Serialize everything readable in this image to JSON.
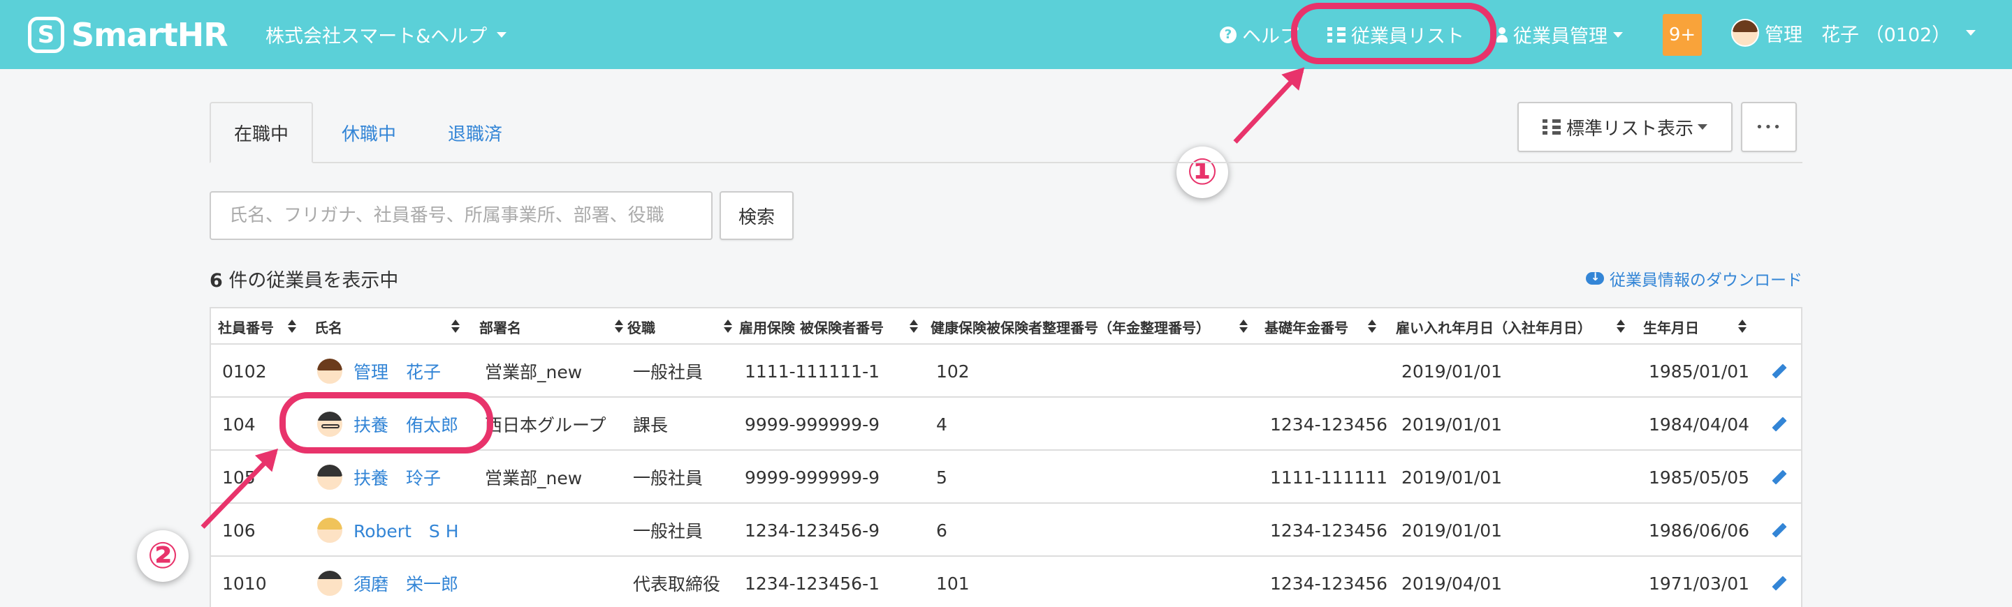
{
  "header": {
    "logo_text": "SmartHR",
    "logo_mark": "S",
    "company": "株式会社スマート&ヘルプ",
    "help": "ヘルプ",
    "employee_list": "従業員リスト",
    "employee_manage": "従業員管理",
    "badge": "9+",
    "user": "管理　花子 （0102）"
  },
  "annotations": {
    "one": "①",
    "two": "②"
  },
  "tabs": [
    "在職中",
    "休職中",
    "退職済"
  ],
  "view_button": "標準リスト表示",
  "more_button": "•••",
  "search": {
    "placeholder": "氏名、フリガナ、社員番号、所属事業所、部署、役職",
    "button": "検索"
  },
  "count": {
    "number": "6",
    "text": " 件の従業員を表示中"
  },
  "download": "従業員情報のダウンロード",
  "columns": [
    "社員番号",
    "氏名",
    "部署名",
    "役職",
    "雇用保険 被保険者番号",
    "健康保険被保険者整理番号（年金整理番号）",
    "基礎年金番号",
    "雇い入れ年月日（入社年月日）",
    "生年月日"
  ],
  "rows": [
    {
      "id": "0102",
      "name": "管理　花子",
      "dept": "営業部_new",
      "title": "一般社員",
      "employment_ins": "1111-111111-1",
      "health_ins": "102",
      "pension": "",
      "hired": "2019/01/01",
      "birth": "1985/01/01"
    },
    {
      "id": "104",
      "name": "扶養　侑太郎",
      "dept": "西日本グループ",
      "title": "課長",
      "employment_ins": "9999-999999-9",
      "health_ins": "4",
      "pension": "1234-123456",
      "hired": "2019/01/01",
      "birth": "1984/04/04"
    },
    {
      "id": "105",
      "name": "扶養　玲子",
      "dept": "営業部_new",
      "title": "一般社員",
      "employment_ins": "9999-999999-9",
      "health_ins": "5",
      "pension": "1111-111111",
      "hired": "2019/01/01",
      "birth": "1985/05/05"
    },
    {
      "id": "106",
      "name": "Robert　S H",
      "dept": "",
      "title": "一般社員",
      "employment_ins": "1234-123456-9",
      "health_ins": "6",
      "pension": "1234-123456",
      "hired": "2019/01/01",
      "birth": "1986/06/06"
    },
    {
      "id": "1010",
      "name": "須磨　栄一郎",
      "dept": "",
      "title": "代表取締役",
      "employment_ins": "1234-123456-1",
      "health_ins": "101",
      "pension": "1234-123456",
      "hired": "2019/04/01",
      "birth": "1971/03/01"
    }
  ],
  "colors": {
    "nav": "#5bd0d8",
    "link": "#3385d6",
    "badge": "#f9a33a",
    "annotation": "#e8336b"
  }
}
